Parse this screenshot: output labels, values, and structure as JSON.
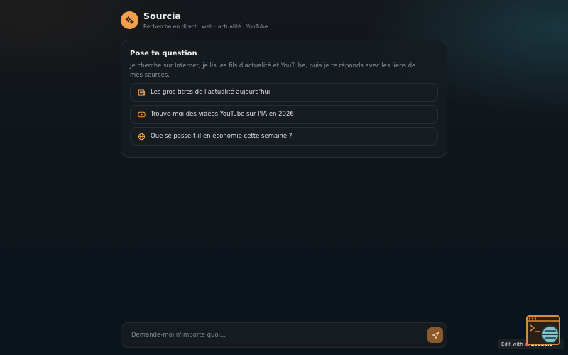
{
  "app": {
    "title": "Sourcia",
    "subtitle": "Recherche en direct : web · actualité · YouTube"
  },
  "intro": {
    "title": "Pose ta question",
    "description": "Je cherche sur Internet, je lis les fils d'actualité et YouTube, puis je te réponds avec les liens de mes sources."
  },
  "suggestions": [
    {
      "icon": "newspaper-icon",
      "label": "Les gros titres de l'actualité aujourd'hui"
    },
    {
      "icon": "youtube-icon",
      "label": "Trouve-moi des vidéos YouTube sur l'IA en 2026"
    },
    {
      "icon": "globe-icon",
      "label": "Que se passe-t-il en économie cette semaine ?"
    }
  ],
  "composer": {
    "placeholder": "Demande-moi n'importe quoi...",
    "value": ""
  },
  "badge": {
    "prefix": "Edit with",
    "brand": "Lovable"
  },
  "colors": {
    "accent": "#f2a14a",
    "send_button": "#8a5a2c",
    "background": "#0f151b"
  }
}
